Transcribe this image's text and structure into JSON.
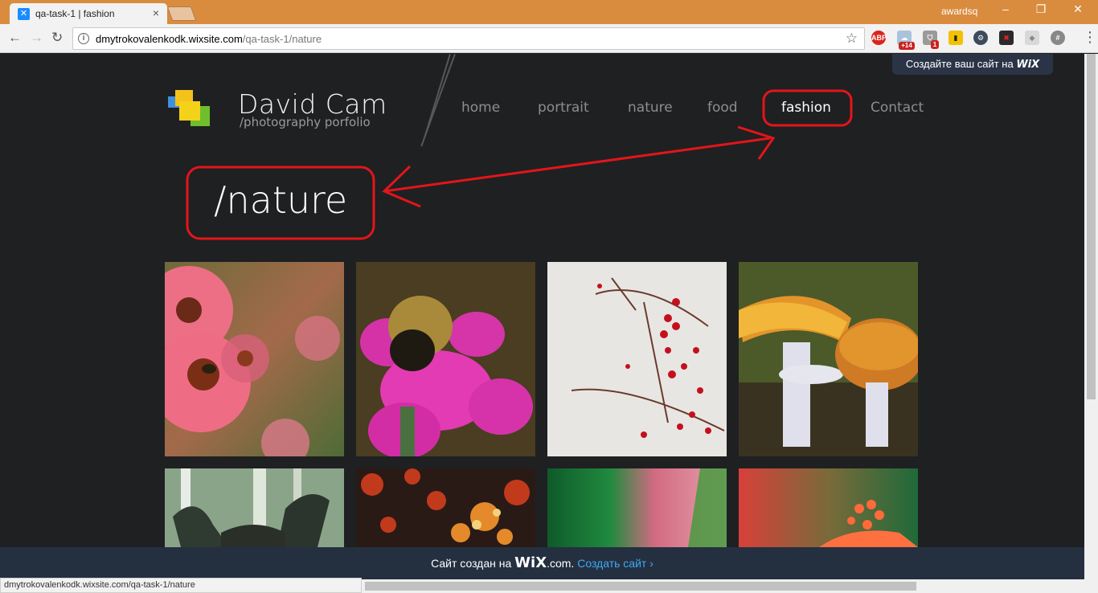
{
  "browser": {
    "tab_title": "qa-task-1 | fashion",
    "profile_name": "awardsq",
    "url_host": "dmytrokovalenkodk.wixsite.com",
    "url_path": "/qa-task-1/nature",
    "status_url": "dmytrokovalenkodk.wixsite.com/qa-task-1/nature",
    "extensions": [
      {
        "name": "adblock-plus-icon",
        "label": "ABP",
        "color": "#d9261c"
      },
      {
        "name": "cloud-badge-icon",
        "label": "+14",
        "color": "#cc2222"
      },
      {
        "name": "shield-badge-icon",
        "label": "1",
        "color": "#cc2222"
      }
    ]
  },
  "site": {
    "wix_top_banner": "Создайте ваш сайт на ",
    "wix_brand": "WiX",
    "title": "David Cam",
    "subtitle": "/photography porfolio",
    "nav": [
      {
        "label": "home",
        "active": false
      },
      {
        "label": "portrait",
        "active": false
      },
      {
        "label": "nature",
        "active": false
      },
      {
        "label": "food",
        "active": false
      },
      {
        "label": "fashion",
        "active": true
      },
      {
        "label": "Contact",
        "active": false
      }
    ],
    "page_heading": "/nature",
    "gallery": [
      "echinacea-flowers",
      "bumblebee-on-phlox",
      "red-berries-branch",
      "orange-mushrooms",
      "moose-antlers",
      "autumn-maple-leaves",
      "green-pink-blur",
      "red-flower-stamens"
    ]
  },
  "footer": {
    "prefix": "Сайт создан на ",
    "brand": "WiX",
    "brand_domain": ".com.",
    "cta": "Создать сайт ›"
  },
  "colors": {
    "background": "#1f2022",
    "annotation": "#e3151a",
    "accent_link": "#3fa9f5"
  }
}
